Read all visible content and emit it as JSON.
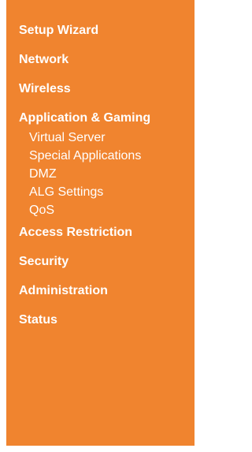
{
  "sidebar": {
    "background": "#F0842F",
    "text_color": "#FFFFFF",
    "items": [
      {
        "label": "Setup Wizard"
      },
      {
        "label": "Network"
      },
      {
        "label": "Wireless"
      },
      {
        "label": "Application & Gaming",
        "subitems": [
          {
            "label": "Virtual Server"
          },
          {
            "label": "Special Applications"
          },
          {
            "label": "DMZ"
          },
          {
            "label": "ALG Settings"
          },
          {
            "label": "QoS"
          }
        ]
      },
      {
        "label": "Access Restriction"
      },
      {
        "label": "Security"
      },
      {
        "label": "Administration"
      },
      {
        "label": "Status"
      }
    ]
  }
}
